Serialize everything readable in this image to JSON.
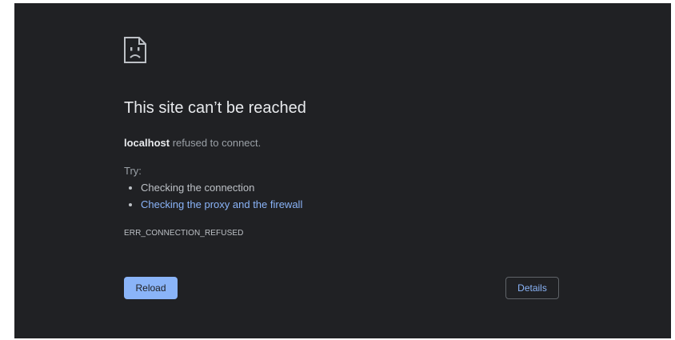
{
  "error_page": {
    "icon": "sad-page-icon",
    "title": "This site can’t be reached",
    "host": "localhost",
    "message_suffix": " refused to connect.",
    "try_label": "Try:",
    "suggestions": [
      {
        "text": "Checking the connection",
        "is_link": false
      },
      {
        "text": "Checking the proxy and the firewall",
        "is_link": true
      }
    ],
    "error_code": "ERR_CONNECTION_REFUSED",
    "reload_label": "Reload",
    "details_label": "Details"
  },
  "colors": {
    "background": "#202124",
    "title_text": "#e8eaed",
    "secondary_text": "#9aa0a6",
    "link": "#8ab4f8",
    "primary_button": "#8ab4f8",
    "outline": "#5f6368"
  }
}
